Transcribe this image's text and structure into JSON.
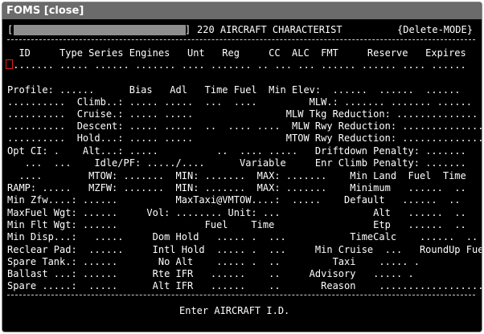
{
  "window": {
    "title": "FOMS [close]"
  },
  "header": {
    "open_bracket": "[",
    "close_bracket": "]",
    "title": "220 AIRCRAFT CHARACTERIST",
    "mode": "{Delete-MODE}"
  },
  "columns": {
    "headers": "  ID     Type Series Engines   Unt   Reg     CC  ALC  FMT     Reserve   Expires",
    "values": " ....... ..... ...... ....... .... ....... .. ... ... ...... ...... .... ......"
  },
  "form_lines": [
    "Profile: ......      Bias   Adl   Time Fuel  Min Elev:  ......  ......  ......",
    "..........  Climb..: ..... .....  ...  ....         MLW.: ....... ....... ......",
    "..........  Cruise.: ..... .....                MLW Tkg Reduction: ..............",
    "..........  Descent: ..... .....  ..  .... ....  MLW Rwy Reduction: ..............",
    "..........  Hold...: ..... .....                MTOW Rwy Reduction: ..............",
    "Opt CI: .    Alt...: .....          ..  .... .....   Driftdown Penalty: .......",
    "   ...  ...    Idle/PF: ...../....      Variable     Enr Climb Penalty: .......",
    "  ....        MTOW: .......  MIN: .......  MAX: .......    Min Land  Fuel  Time",
    "RAMP: .....   MZFW: .......  MIN: .......  MAX: .......    Minimum   ......  ..",
    "Min Zfw....: ......          MaxTaxi@VMTOW....:  .....    Default   ......  ..",
    "MaxFuel Wgt: ......     Vol: ........ Unit: ...                Alt   ......  ..",
    "Min Flt Wgt: ......               Fuel    Time                 Etp   ......  ..",
    "Min Disp...:   .....     Dom Hold   ..... .  ...           TimeCalc    ......  ..",
    "Reclear Pad:  ......     Intl Hold  ..... .  ...     Min Cruise  ...   RoundUp Fuel .",
    "Spare Tank.: ......       No Alt    ..... .  ..         Taxi    ..... .",
    "Ballast ...: ......      Rte IFR   ......    ..     Advisory   ..... .",
    "Spare .....:  .....      Alt IFR   ......    ..       Reason    .................."
  ],
  "footer": {
    "prompt": "Enter AIRCRAFT I.D."
  },
  "colors": {
    "background": "#000000",
    "text": "#ffffff",
    "titlebar": "#6b6b6b",
    "cursor": "#e02020"
  }
}
